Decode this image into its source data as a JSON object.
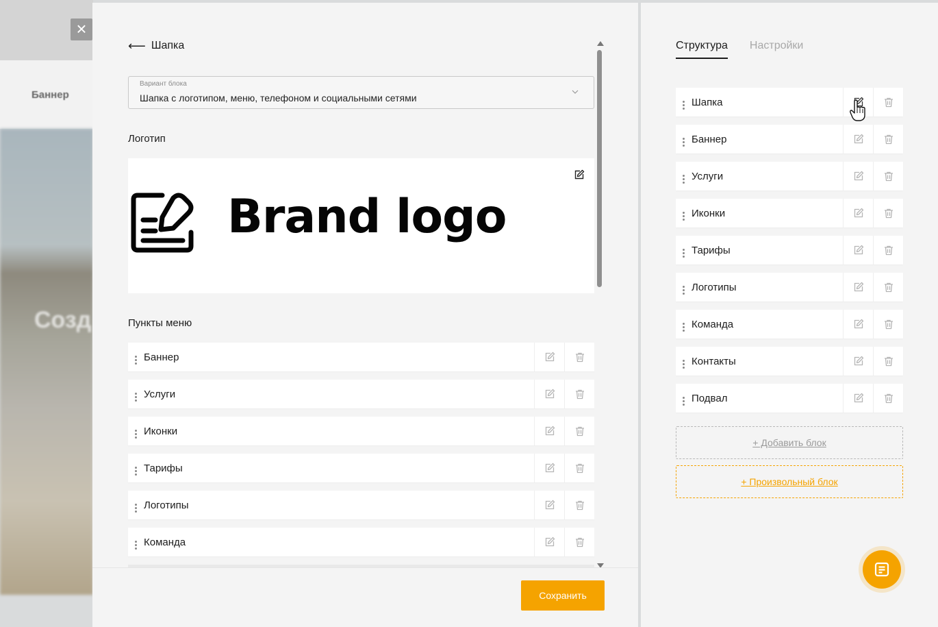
{
  "background": {
    "nav_item": "Баннер",
    "hero_text": "Созд",
    "close_icon": "×"
  },
  "editor": {
    "back_arrow": "⟵",
    "title": "Шапка",
    "variant": {
      "label": "Вариант блока",
      "value": "Шапка с логотипом, меню, телефоном и социальными сетями"
    },
    "logo_section": "Логотип",
    "logo_text": "Brand logo",
    "menu_section": "Пункты меню",
    "menu_items": [
      {
        "label": "Баннер"
      },
      {
        "label": "Услуги"
      },
      {
        "label": "Иконки"
      },
      {
        "label": "Тарифы"
      },
      {
        "label": "Логотипы"
      },
      {
        "label": "Команда"
      }
    ],
    "save_label": "Сохранить"
  },
  "structure": {
    "tabs": [
      {
        "label": "Структура",
        "active": true
      },
      {
        "label": "Настройки",
        "active": false
      }
    ],
    "blocks": [
      {
        "label": "Шапка"
      },
      {
        "label": "Баннер"
      },
      {
        "label": "Услуги"
      },
      {
        "label": "Иконки"
      },
      {
        "label": "Тарифы"
      },
      {
        "label": "Логотипы"
      },
      {
        "label": "Команда"
      },
      {
        "label": "Контакты"
      },
      {
        "label": "Подвал"
      }
    ],
    "add_block": "+ Добавить блок",
    "custom_block": "+ Произвольный блок"
  },
  "colors": {
    "accent": "#f5a300",
    "text": "#1c1c1c",
    "muted": "#a8a8a8"
  },
  "icons": {
    "edit": "edit-icon",
    "delete": "trash-icon",
    "drag": "drag-handle-icon",
    "chat": "chat-icon"
  }
}
